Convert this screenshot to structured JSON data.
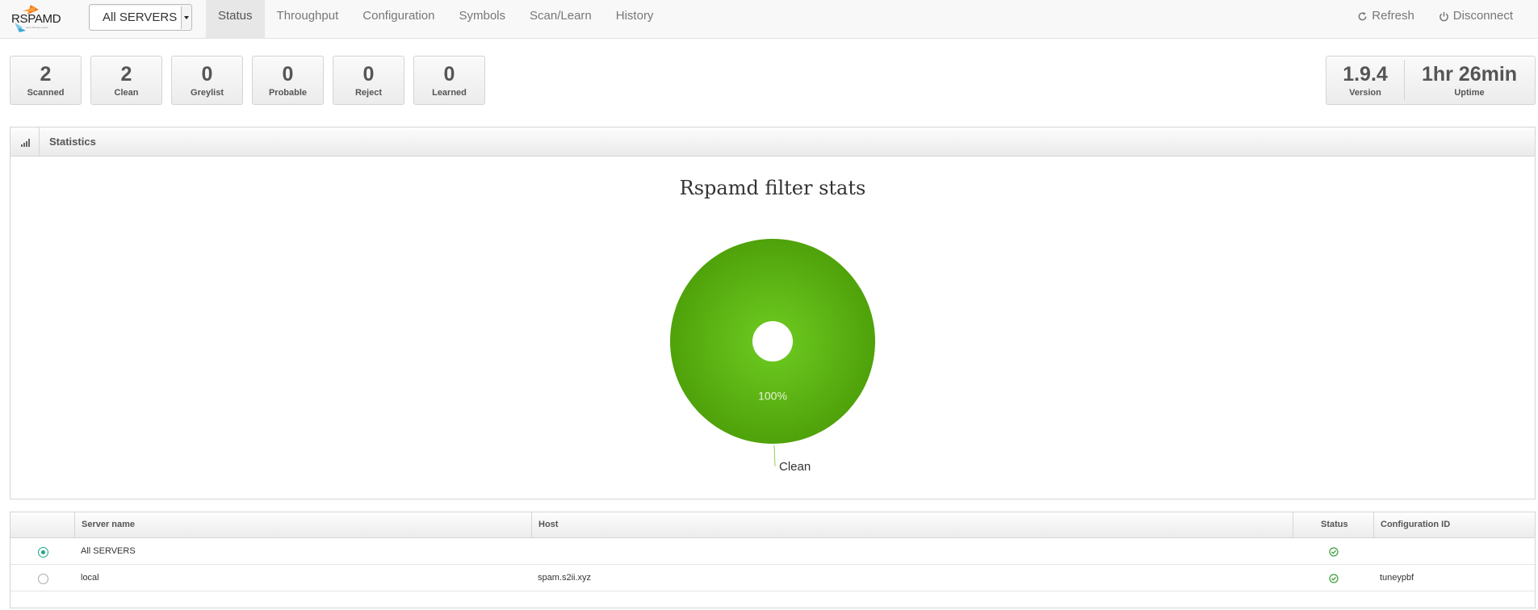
{
  "navbar": {
    "logo_text": "RSPAMD",
    "logo_sub": "spam filtering system",
    "server_select": "All SERVERS",
    "tabs": [
      "Status",
      "Throughput",
      "Configuration",
      "Symbols",
      "Scan/Learn",
      "History"
    ],
    "active_tab": "Status",
    "refresh_label": "Refresh",
    "disconnect_label": "Disconnect"
  },
  "stats": [
    {
      "value": "2",
      "label": "Scanned"
    },
    {
      "value": "2",
      "label": "Clean"
    },
    {
      "value": "0",
      "label": "Greylist"
    },
    {
      "value": "0",
      "label": "Probable"
    },
    {
      "value": "0",
      "label": "Reject"
    },
    {
      "value": "0",
      "label": "Learned"
    }
  ],
  "server_info": [
    {
      "value": "1.9.4",
      "label": "Version"
    },
    {
      "value": "1hr 26min",
      "label": "Uptime"
    }
  ],
  "statistics_widget": {
    "title": "Statistics"
  },
  "chart_data": {
    "type": "pie",
    "title": "Rspamd filter stats",
    "categories": [
      "Clean"
    ],
    "values": [
      100
    ],
    "data_labels": [
      "100%"
    ],
    "colors": [
      "#5cb82e"
    ]
  },
  "server_table": {
    "headers": [
      "Server name",
      "Host",
      "Status",
      "Configuration ID"
    ],
    "rows": [
      {
        "selected": true,
        "name": "All SERVERS",
        "host": "",
        "status": "ok",
        "config_id": ""
      },
      {
        "selected": false,
        "name": "local",
        "host": "spam.s2ii.xyz",
        "status": "ok",
        "config_id": "tuneypbf"
      }
    ]
  },
  "colors": {
    "accent_green": "#1fa589",
    "status_ok": "#3a9d3a",
    "chart_green": "#5cb82e"
  }
}
